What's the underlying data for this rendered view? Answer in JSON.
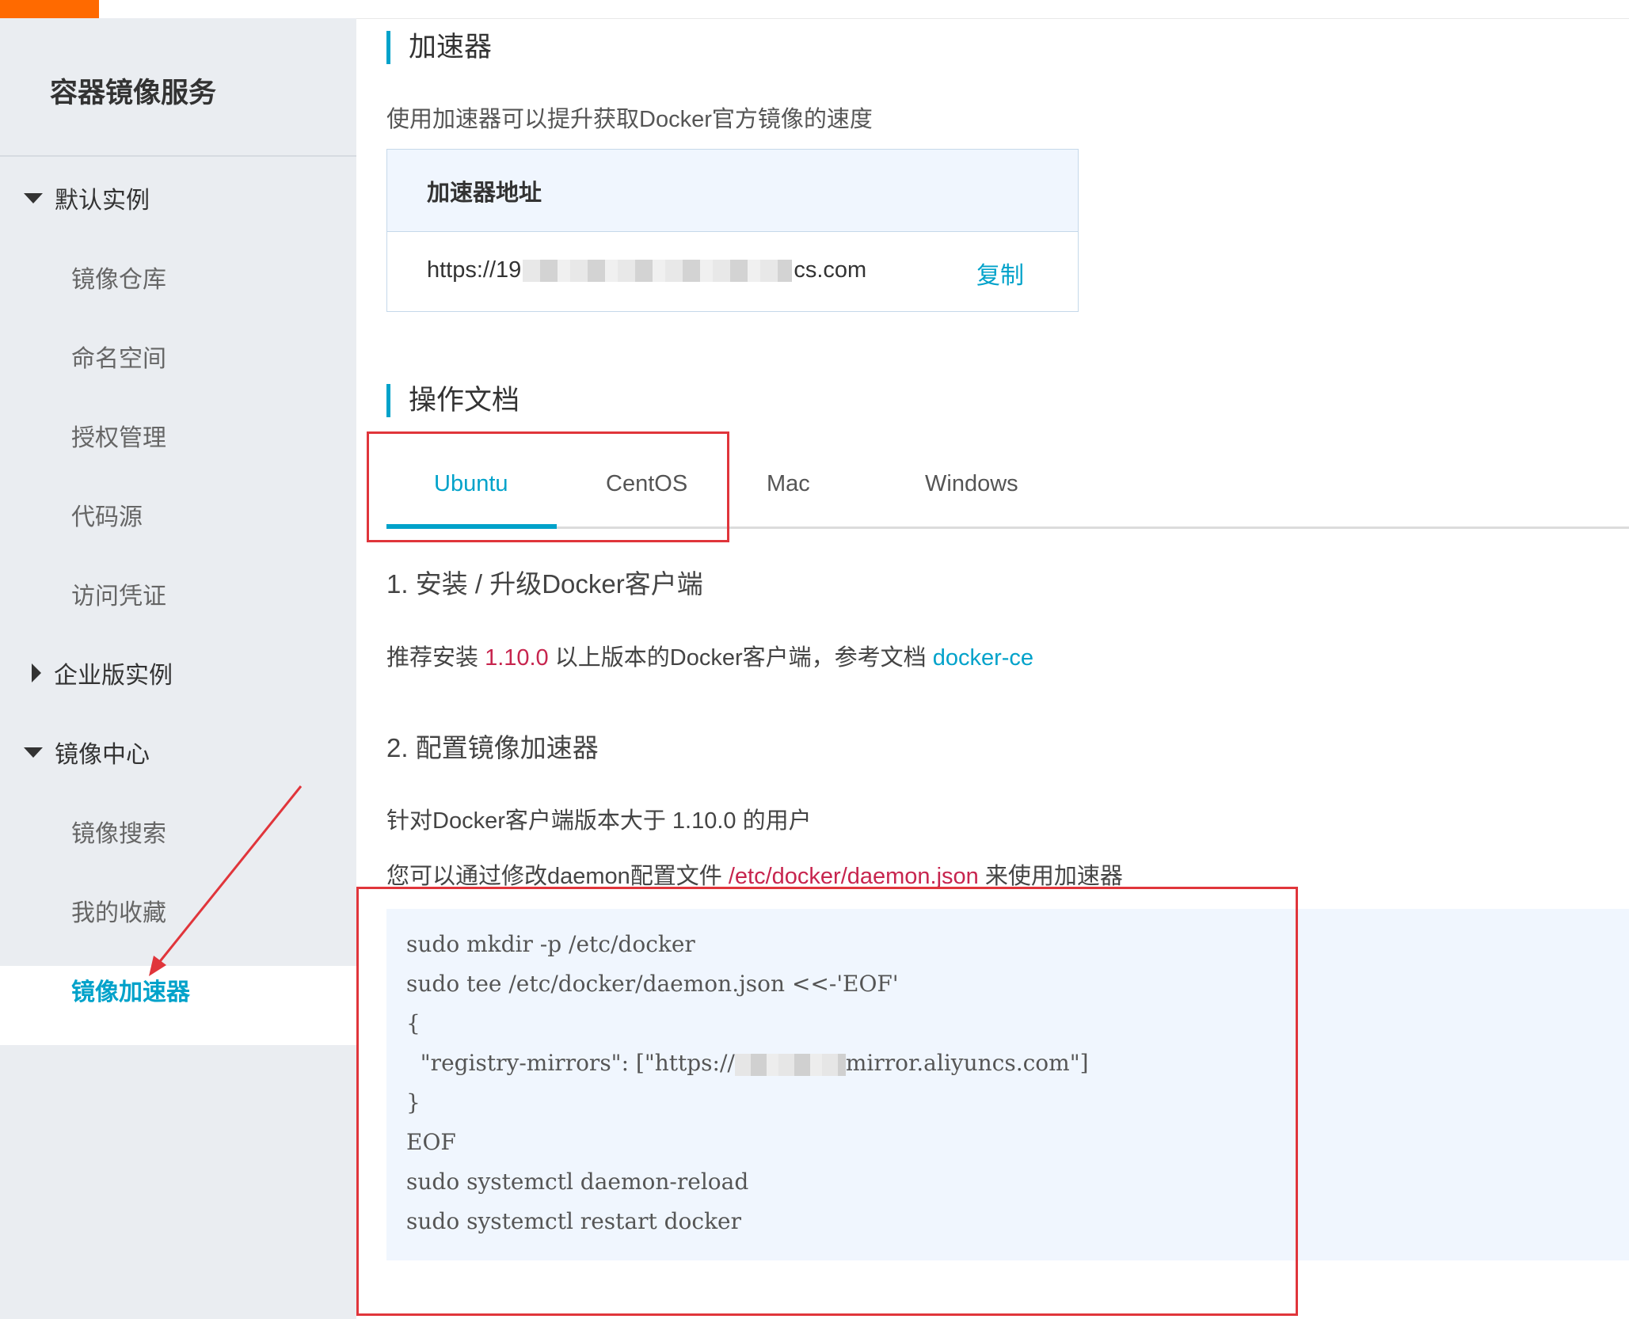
{
  "sidebar": {
    "title": "容器镜像服务",
    "groups": [
      {
        "label": "默认实例",
        "items": [
          "镜像仓库",
          "命名空间",
          "授权管理",
          "代码源",
          "访问凭证"
        ]
      },
      {
        "label": "企业版实例"
      },
      {
        "label": "镜像中心",
        "items": [
          "镜像搜索",
          "我的收藏",
          "镜像加速器"
        ]
      }
    ],
    "active_item": "镜像加速器"
  },
  "accelerator": {
    "heading": "加速器",
    "description": "使用加速器可以提升获取Docker官方镜像的速度",
    "box_header": "加速器地址",
    "url_prefix": "https://19",
    "url_suffix": "cs.com",
    "copy_label": "复制"
  },
  "docs": {
    "heading": "操作文档",
    "tabs": [
      "Ubuntu",
      "CentOS",
      "Mac",
      "Windows"
    ],
    "active_tab": "Ubuntu",
    "step1": {
      "title": "1. 安装 / 升级Docker客户端",
      "text_before": "推荐安装 ",
      "version": "1.10.0",
      "text_after": " 以上版本的Docker客户端，参考文档 ",
      "link": "docker-ce"
    },
    "step2": {
      "title": "2. 配置镜像加速器",
      "line1": "针对Docker客户端版本大于 1.10.0 的用户",
      "line2_before": "您可以通过修改daemon配置文件 ",
      "line2_path": "/etc/docker/daemon.json",
      "line2_after": " 来使用加速器"
    },
    "code": [
      "sudo mkdir -p /etc/docker",
      "sudo tee /etc/docker/daemon.json <<-'EOF'",
      "{",
      "  \"registry-mirrors\": [\"https://",
      "}",
      "EOF",
      "sudo systemctl daemon-reload",
      "sudo systemctl restart docker"
    ],
    "code_mirror_suffix": "mirror.aliyuncs.com\"]"
  },
  "colors": {
    "accent": "#00a2ca",
    "brand": "#ff6a00",
    "highlight": "#e0353b",
    "code_red": "#c7254e"
  }
}
